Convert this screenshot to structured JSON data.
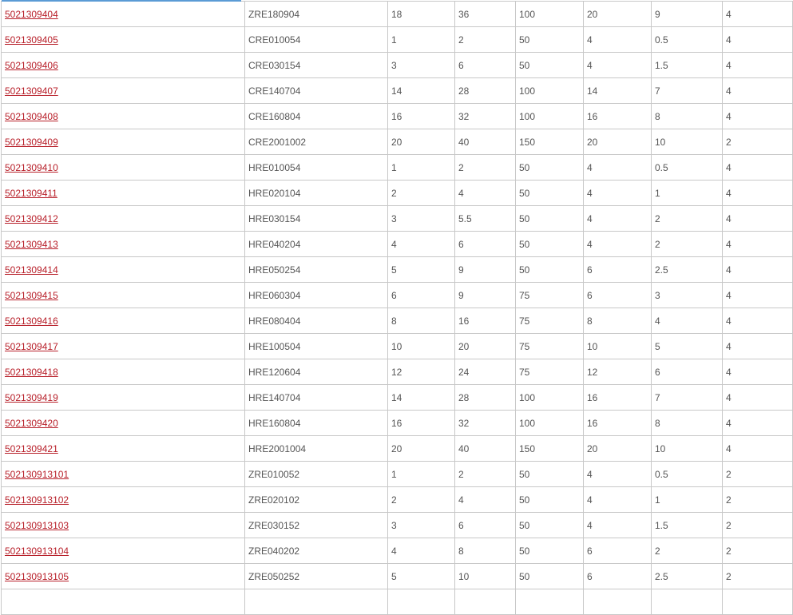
{
  "table": {
    "rows": [
      {
        "part": "5021309404",
        "model": "ZRE180904",
        "c1": "18",
        "c2": "36",
        "c3": "100",
        "c4": "20",
        "c5": "9",
        "c6": "4"
      },
      {
        "part": "5021309405",
        "model": "CRE010054",
        "c1": "1",
        "c2": "2",
        "c3": "50",
        "c4": "4",
        "c5": "0.5",
        "c6": "4"
      },
      {
        "part": "5021309406",
        "model": "CRE030154",
        "c1": "3",
        "c2": "6",
        "c3": "50",
        "c4": "4",
        "c5": "1.5",
        "c6": "4"
      },
      {
        "part": "5021309407",
        "model": "CRE140704",
        "c1": "14",
        "c2": "28",
        "c3": "100",
        "c4": "14",
        "c5": "7",
        "c6": "4"
      },
      {
        "part": "5021309408",
        "model": "CRE160804",
        "c1": "16",
        "c2": "32",
        "c3": "100",
        "c4": "16",
        "c5": "8",
        "c6": "4"
      },
      {
        "part": "5021309409",
        "model": "CRE2001002",
        "c1": "20",
        "c2": "40",
        "c3": "150",
        "c4": "20",
        "c5": "10",
        "c6": "2"
      },
      {
        "part": "5021309410",
        "model": "HRE010054",
        "c1": "1",
        "c2": "2",
        "c3": "50",
        "c4": "4",
        "c5": "0.5",
        "c6": "4"
      },
      {
        "part": "5021309411",
        "model": "HRE020104",
        "c1": "2",
        "c2": "4",
        "c3": "50",
        "c4": "4",
        "c5": "1",
        "c6": "4"
      },
      {
        "part": "5021309412",
        "model": "HRE030154",
        "c1": "3",
        "c2": "5.5",
        "c3": "50",
        "c4": "4",
        "c5": "2",
        "c6": "4"
      },
      {
        "part": "5021309413",
        "model": "HRE040204",
        "c1": "4",
        "c2": "6",
        "c3": "50",
        "c4": "4",
        "c5": "2",
        "c6": "4"
      },
      {
        "part": "5021309414",
        "model": "HRE050254",
        "c1": "5",
        "c2": "9",
        "c3": "50",
        "c4": "6",
        "c5": "2.5",
        "c6": "4"
      },
      {
        "part": "5021309415",
        "model": "HRE060304",
        "c1": "6",
        "c2": "9",
        "c3": "75",
        "c4": "6",
        "c5": "3",
        "c6": "4"
      },
      {
        "part": "5021309416",
        "model": "HRE080404",
        "c1": "8",
        "c2": "16",
        "c3": "75",
        "c4": "8",
        "c5": "4",
        "c6": "4"
      },
      {
        "part": "5021309417",
        "model": "HRE100504",
        "c1": "10",
        "c2": "20",
        "c3": "75",
        "c4": "10",
        "c5": "5",
        "c6": "4"
      },
      {
        "part": "5021309418",
        "model": "HRE120604",
        "c1": "12",
        "c2": "24",
        "c3": "75",
        "c4": "12",
        "c5": "6",
        "c6": "4"
      },
      {
        "part": "5021309419",
        "model": "HRE140704",
        "c1": "14",
        "c2": "28",
        "c3": "100",
        "c4": "16",
        "c5": "7",
        "c6": "4"
      },
      {
        "part": "5021309420",
        "model": "HRE160804",
        "c1": "16",
        "c2": "32",
        "c3": "100",
        "c4": "16",
        "c5": "8",
        "c6": "4"
      },
      {
        "part": "5021309421",
        "model": "HRE2001004",
        "c1": "20",
        "c2": "40",
        "c3": "150",
        "c4": "20",
        "c5": "10",
        "c6": "4"
      },
      {
        "part": "502130913101",
        "model": "ZRE010052",
        "c1": "1",
        "c2": "2",
        "c3": "50",
        "c4": "4",
        "c5": "0.5",
        "c6": "2"
      },
      {
        "part": "502130913102",
        "model": "ZRE020102",
        "c1": "2",
        "c2": "4",
        "c3": "50",
        "c4": "4",
        "c5": "1",
        "c6": "2"
      },
      {
        "part": "502130913103",
        "model": "ZRE030152",
        "c1": "3",
        "c2": "6",
        "c3": "50",
        "c4": "4",
        "c5": "1.5",
        "c6": "2"
      },
      {
        "part": "502130913104",
        "model": "ZRE040202",
        "c1": "4",
        "c2": "8",
        "c3": "50",
        "c4": "6",
        "c5": "2",
        "c6": "2"
      },
      {
        "part": "502130913105",
        "model": "ZRE050252",
        "c1": "5",
        "c2": "10",
        "c3": "50",
        "c4": "6",
        "c5": "2.5",
        "c6": "2"
      },
      {
        "part": "",
        "model": "",
        "c1": "",
        "c2": "",
        "c3": "",
        "c4": "",
        "c5": "",
        "c6": ""
      }
    ]
  },
  "colors": {
    "link": "#b8202a",
    "text": "#555555",
    "border": "#c8c8c8",
    "accent": "#5b9bd5"
  }
}
